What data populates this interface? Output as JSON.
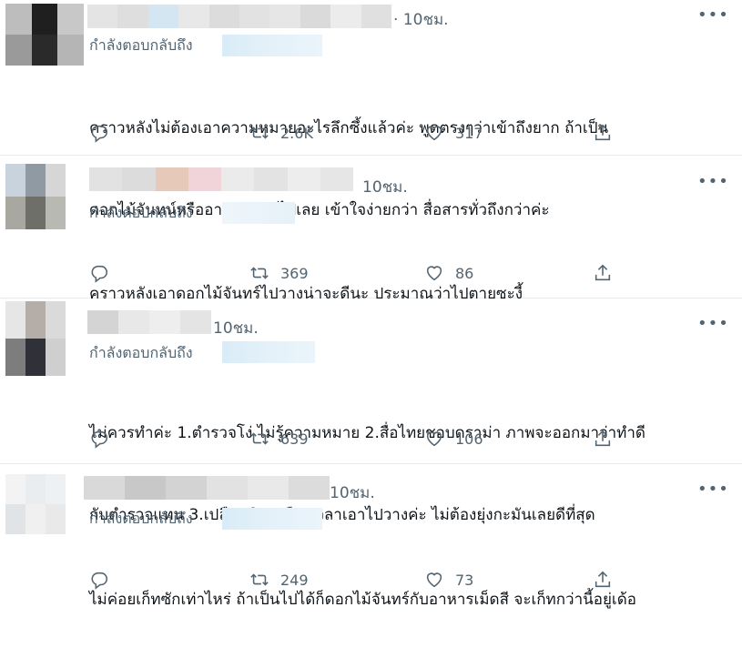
{
  "tweets": [
    {
      "time": "· 10ชม.",
      "replying_label": "กำลังตอบกลับถึง",
      "text_lines": [
        "คราวหลังไม่ต้องเอาความหมายอะไรลึกซึ้งแล้วค่ะ พูดตรงๆว่าเข้าถึงยาก ถ้าเป็น",
        "ดอกไม้จันทน์หรืออาหารหมาไปเลย เข้าใจง่ายกว่า สื่อสารทั่วถึงกว่าค่ะ"
      ],
      "retweets": "2.6K",
      "likes": "317",
      "avatar_colors": [
        "#bdbdbd",
        "#1f1f1f",
        "#c8c8c8",
        "#9a9a9a",
        "#2a2a2a",
        "#b5b5b5"
      ],
      "name_colors": [
        "#e4e4e4",
        "#dedede",
        "#d3e6f2",
        "#e8e8e8",
        "#dcdcdc",
        "#e2e2e2",
        "#e6e6e6",
        "#dadada",
        "#ececec",
        "#e0e0e0"
      ]
    },
    {
      "time": "10ชม.",
      "replying_label": "กำลังตอบกลับถึง",
      "text_lines": [
        "คราวหลังเอาดอกไม้จันทร์ไปวางน่าจะดีนะ ประมาณว่าไปตายซะงี้"
      ],
      "retweets": "369",
      "likes": "86",
      "avatar_colors": [
        "#c9d3dd",
        "#8f9aa3",
        "#d6d6d6",
        "#a8a8a0",
        "#6f6f6a",
        "#b9b9b4"
      ],
      "name_colors": [
        "#e2e2e2",
        "#dcdcdc",
        "#e6c9b8",
        "#f1d4d9",
        "#ebebeb",
        "#e3e3e3",
        "#ededed",
        "#e6e6e6"
      ]
    },
    {
      "time": "10ชม.",
      "replying_label": "กำลังตอบกลับถึง",
      "text_lines": [
        "ไม่ควรทำค่ะ 1.ตำรวจโง่ ไม่รู้ความหมาย 2.สื่อไทยชอบดราม่า ภาพจะออกมาว่าทำดี",
        "กับตำรวจแทน 3.เปลืองเงินเปลืองเวลาเอาไปวางค่ะ ไม่ต้องยุ่งกะมันเลยดีที่สุด"
      ],
      "retweets": "639",
      "likes": "106",
      "avatar_colors": [
        "#e6e6e6",
        "#b5aea8",
        "#dadada",
        "#7d7d7d",
        "#2f3038",
        "#cfcfcf"
      ],
      "name_colors": [
        "#d4d4d4",
        "#e8e8e8",
        "#eeeeee",
        "#e4e4e4"
      ]
    },
    {
      "time": "10ชม.",
      "replying_label": "กำลังตอบกลับถึง",
      "text_lines": [
        "ไม่ค่อยเก็ทซักเท่าไหร่ ถ้าเป็นไปได้ก็ดอกไม้จันทร์กับอาหารเม็ดสี จะเก็ทกว่านี้อยู่เด้อ"
      ],
      "retweets": "249",
      "likes": "73",
      "avatar_colors": [
        "#f3f3f3",
        "#e9edf0",
        "#eef1f3",
        "#e1e4e6",
        "#f0f0f0",
        "#e9e9e9"
      ],
      "name_colors": [
        "#d9d9d9",
        "#c8c8c8",
        "#d3d3d3",
        "#e2e2e2",
        "#e9e9e9",
        "#dcdcdc"
      ]
    }
  ],
  "icons": {
    "reply": "reply-icon",
    "retweet": "retweet-icon",
    "like": "heart-icon",
    "share": "share-icon",
    "more": "more-icon"
  },
  "more_glyph": "•••"
}
